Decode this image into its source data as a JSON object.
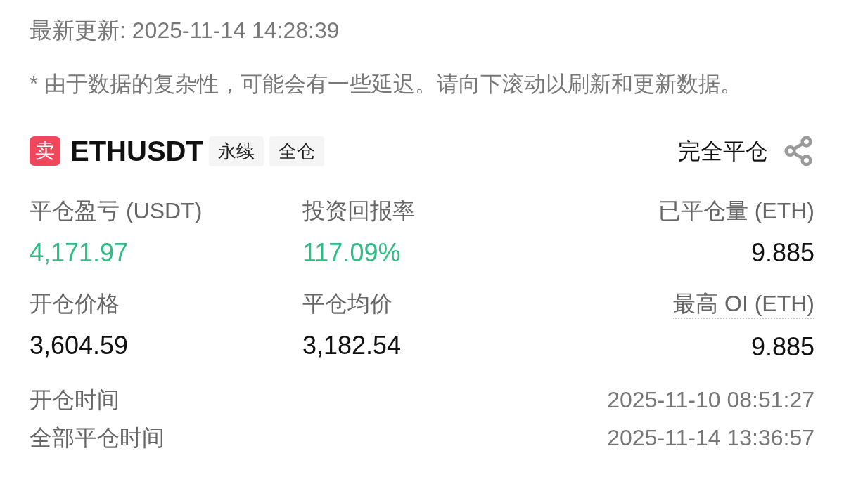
{
  "last_update": "最新更新: 2025-11-14 14:28:39",
  "disclaimer": "* 由于数据的复杂性，可能会有一些延迟。请向下滚动以刷新和更新数据。",
  "position": {
    "side": {
      "label": "卖",
      "kind": "sell"
    },
    "symbol": "ETHUSDT",
    "tags": [
      "永续",
      "全仓"
    ],
    "status": "完全平仓"
  },
  "metrics": [
    {
      "label": "平仓盈亏 (USDT)",
      "value": "4,171.97",
      "color": "#2ebd85",
      "dotted_underline": false
    },
    {
      "label": "投资回报率",
      "value": "117.09%",
      "color": "#2ebd85",
      "dotted_underline": false
    },
    {
      "label": "已平仓量 (ETH)",
      "value": "9.885",
      "color": "#111111",
      "dotted_underline": false
    },
    {
      "label": "开仓价格",
      "value": "3,604.59",
      "color": "#111111",
      "dotted_underline": false
    },
    {
      "label": "平仓均价",
      "value": "3,182.54",
      "color": "#111111",
      "dotted_underline": false
    },
    {
      "label": "最高 OI (ETH)",
      "value": "9.885",
      "color": "#111111",
      "dotted_underline": true
    }
  ],
  "times": [
    {
      "label": "开仓时间",
      "value": "2025-11-10 08:51:27"
    },
    {
      "label": "全部平仓时间",
      "value": "2025-11-14 13:36:57"
    }
  ]
}
